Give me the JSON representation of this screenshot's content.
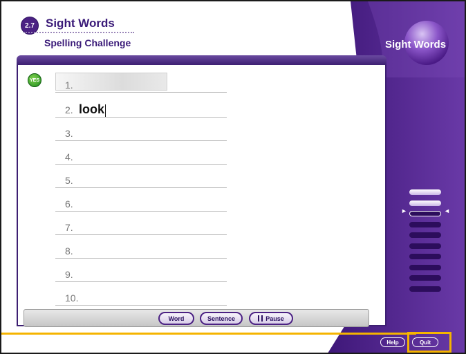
{
  "header": {
    "lesson_number": "2.7",
    "title": "Sight Words",
    "subtitle": "Spelling Challenge"
  },
  "logo": {
    "text": "Sight Words"
  },
  "feedback": {
    "label": "YES"
  },
  "rows": [
    {
      "number": "1.",
      "answer": ""
    },
    {
      "number": "2.",
      "answer": "look"
    },
    {
      "number": "3.",
      "answer": ""
    },
    {
      "number": "4.",
      "answer": ""
    },
    {
      "number": "5.",
      "answer": ""
    },
    {
      "number": "6.",
      "answer": ""
    },
    {
      "number": "7.",
      "answer": ""
    },
    {
      "number": "8.",
      "answer": ""
    },
    {
      "number": "9.",
      "answer": ""
    },
    {
      "number": "10.",
      "answer": ""
    }
  ],
  "toolbar": {
    "word_label": "Word",
    "sentence_label": "Sentence",
    "pause_label": "Pause"
  },
  "bottom": {
    "help_label": "Help",
    "quit_label": "Quit"
  },
  "progress": {
    "total": 10,
    "completed": 2,
    "current": 3
  },
  "colors": {
    "brand_purple": "#5a2a93",
    "accent_yellow": "#f5b400",
    "correct_green": "#1e8a1e"
  }
}
